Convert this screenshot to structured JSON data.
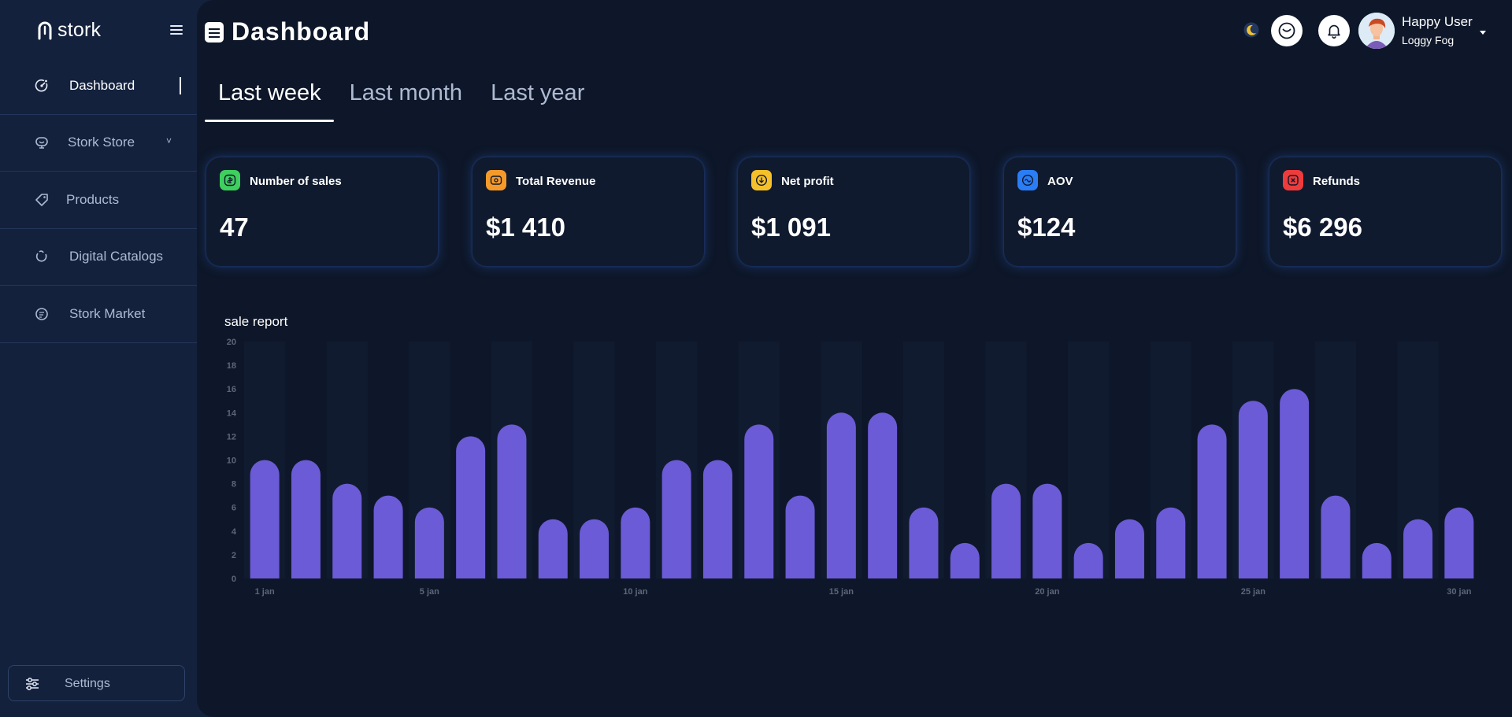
{
  "sidebar": {
    "logo": "stork",
    "items": [
      {
        "label": "Dashboard",
        "icon": "dashboard-icon",
        "active": true
      },
      {
        "label": "Stork Store",
        "icon": "store-icon",
        "has_submenu": true
      },
      {
        "label": "Products",
        "icon": "tag-icon"
      },
      {
        "label": "Digital Catalogs",
        "icon": "catalog-icon"
      },
      {
        "label": "Stork Market",
        "icon": "market-icon"
      }
    ],
    "settings_label": "Settings"
  },
  "header": {
    "title": "Dashboard",
    "user": {
      "name": "Happy User",
      "subtitle": "Loggy Fog"
    }
  },
  "tabs": [
    {
      "label": "Last week",
      "active": true
    },
    {
      "label": "Last month",
      "active": false
    },
    {
      "label": "Last year",
      "active": false
    }
  ],
  "cards": [
    {
      "label": "Number of sales",
      "value": "47",
      "icon": "dollar-icon",
      "color": "#3ecf5e"
    },
    {
      "label": "Total Revenue",
      "value": "$1 410",
      "icon": "wallet-icon",
      "color": "#f59a2a"
    },
    {
      "label": "Net profit",
      "value": "$1 091",
      "icon": "download-icon",
      "color": "#f5c02a"
    },
    {
      "label": "AOV",
      "value": "$124",
      "icon": "aov-icon",
      "color": "#2a7df5"
    },
    {
      "label": "Refunds",
      "value": "$6 296",
      "icon": "refund-icon",
      "color": "#ee3b3b"
    }
  ],
  "chart_data": {
    "type": "bar",
    "title": "sale report",
    "x_tick_labels": [
      "1 jan",
      "5 jan",
      "10 jan",
      "15 jan",
      "20 jan",
      "25 jan",
      "30 jan"
    ],
    "x_tick_days": [
      1,
      5,
      10,
      15,
      20,
      25,
      30
    ],
    "days": [
      1,
      2,
      3,
      4,
      5,
      6,
      7,
      8,
      9,
      10,
      11,
      12,
      13,
      14,
      15,
      16,
      17,
      18,
      19,
      20,
      21,
      22,
      23,
      24,
      25,
      26,
      27,
      28,
      29,
      30
    ],
    "values": [
      10,
      10,
      8,
      7,
      6,
      12,
      13,
      5,
      5,
      6,
      10,
      10,
      13,
      7,
      14,
      14,
      6,
      3,
      8,
      8,
      3,
      5,
      6,
      13,
      15,
      16,
      7,
      3,
      5,
      6
    ],
    "ylim": [
      0,
      20
    ],
    "y_ticks": [
      0,
      2,
      4,
      6,
      8,
      10,
      12,
      14,
      16,
      18,
      20
    ],
    "bar_color": "#6b5bd6",
    "grid": true
  },
  "colors": {
    "sidebar_bg": "#13213d",
    "main_bg": "#0e1729",
    "accent": "#6b5bd6"
  }
}
